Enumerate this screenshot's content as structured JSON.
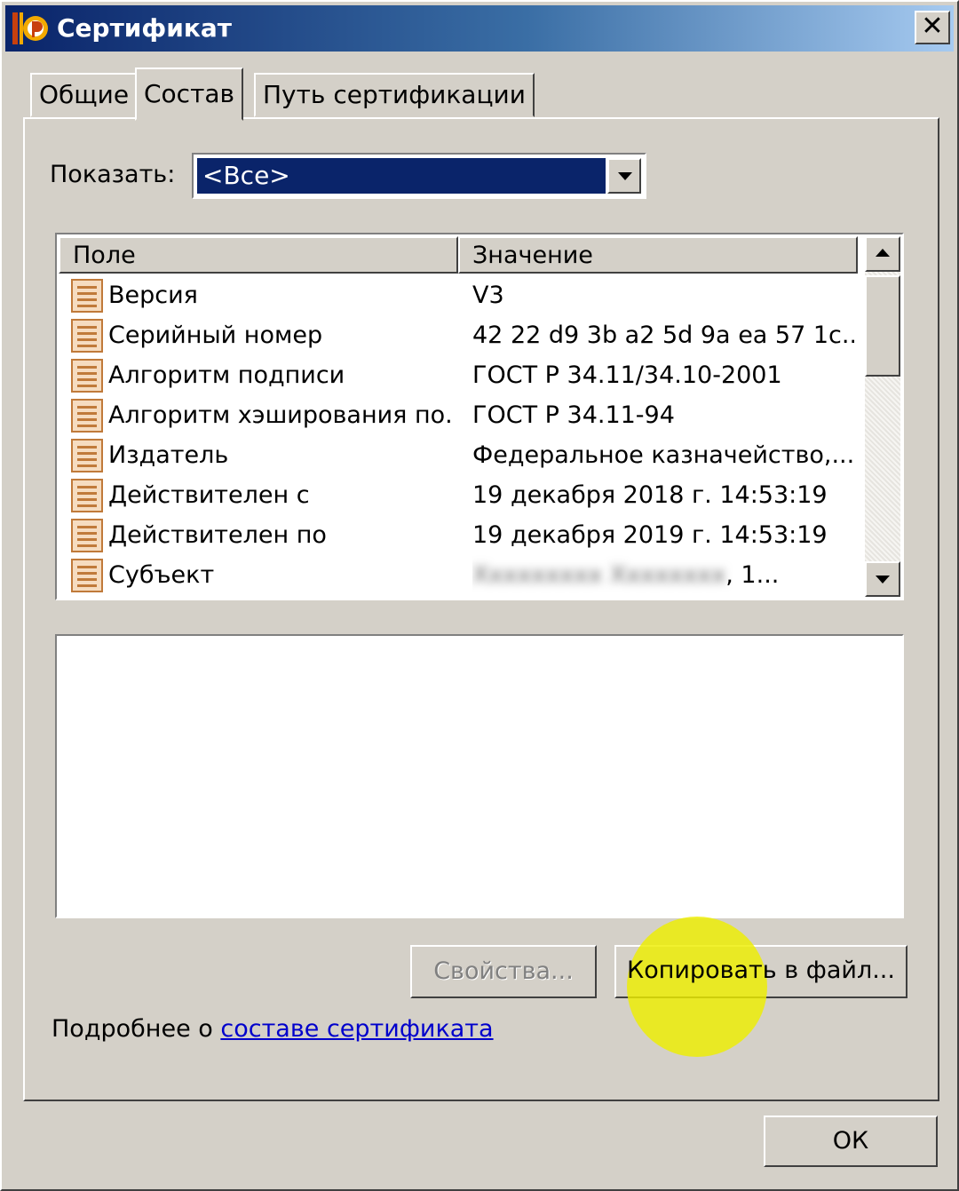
{
  "window": {
    "title": "Сертификат",
    "close_label": "✕"
  },
  "tabs": [
    {
      "label": "Общие",
      "active": false
    },
    {
      "label": "Состав",
      "active": true
    },
    {
      "label": "Путь сертификации",
      "active": false
    }
  ],
  "show": {
    "label": "Показать:",
    "value": "<Все>"
  },
  "fields_table": {
    "columns": [
      "Поле",
      "Значение"
    ],
    "rows": [
      {
        "field": "Версия",
        "value": "V3"
      },
      {
        "field": "Серийный номер",
        "value": "42 22 d9 3b a2 5d 9a ea 57 1c..."
      },
      {
        "field": "Алгоритм подписи",
        "value": "ГОСТ Р 34.11/34.10-2001"
      },
      {
        "field": "Алгоритм хэширования по...",
        "value": "ГОСТ Р 34.11-94"
      },
      {
        "field": "Издатель",
        "value": "Федеральное казначейство,..."
      },
      {
        "field": "Действителен с",
        "value": "19 декабря 2018 г. 14:53:19"
      },
      {
        "field": "Действителен по",
        "value": "19 декабря 2019 г. 14:53:19"
      },
      {
        "field": "Субъект",
        "value": ", 1...",
        "value_obscured": "Xxxxxxxxx Xxxxxxxx"
      }
    ]
  },
  "buttons": {
    "properties": "Свойства...",
    "copy_to_file": "Копировать в файл...",
    "ok": "ОК"
  },
  "more_info": {
    "prefix": "Подробнее о ",
    "link": "составе сертификата "
  },
  "colors": {
    "title_start": "#0a246a",
    "title_end": "#a6caf0",
    "selection": "#0a246a",
    "face": "#d4d0c8",
    "link": "#0000cc",
    "highlight": "#eeee00"
  }
}
